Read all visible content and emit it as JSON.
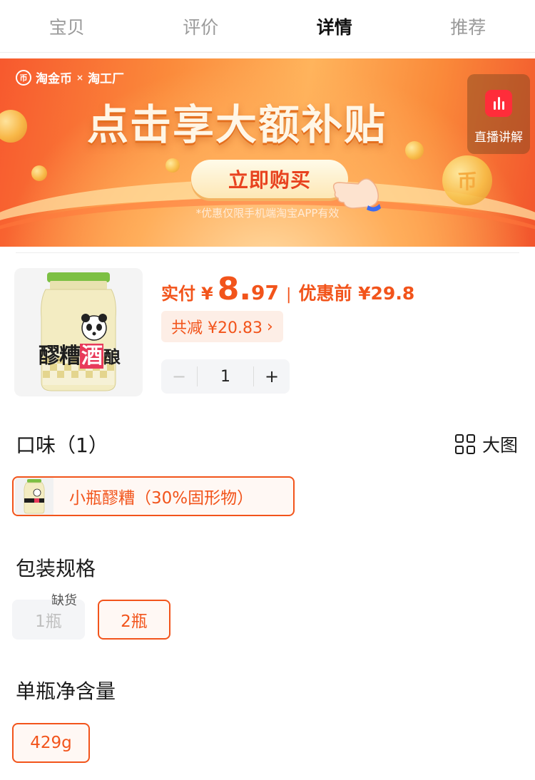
{
  "tabs": [
    {
      "label": "宝贝",
      "active": false
    },
    {
      "label": "评价",
      "active": false
    },
    {
      "label": "详情",
      "active": true
    },
    {
      "label": "推荐",
      "active": false
    }
  ],
  "banner": {
    "brand_left": "淘金币",
    "brand_x": "×",
    "brand_right": "淘工厂",
    "headline": "点击享大额补贴",
    "buy_button": "立即购买",
    "note": "*优惠仅限手机端淘宝APP有效",
    "live_label": "直播讲解",
    "coin_symbol": "币"
  },
  "product": {
    "actual_label": "实付",
    "currency": "¥",
    "price_int": "8.",
    "price_dec": "97",
    "separator": "|",
    "before_label": "优惠前 ¥29.8",
    "discount_text": "共减 ¥20.83",
    "discount_arrow": "›",
    "quantity": "1",
    "minus": "−",
    "plus": "+",
    "jar_label_top": "醪糟",
    "jar_label_accent": "酒",
    "jar_label_end": "酿"
  },
  "flavor": {
    "title": "口味（1）",
    "big_image_label": "大图",
    "options": [
      {
        "label": "小瓶醪糟（30%固形物）",
        "selected": true
      }
    ]
  },
  "package": {
    "title": "包装规格",
    "out_of_stock": "缺货",
    "options": [
      {
        "label": "1瓶",
        "selected": false,
        "disabled": true
      },
      {
        "label": "2瓶",
        "selected": true,
        "disabled": false
      }
    ]
  },
  "net": {
    "title": "单瓶净含量",
    "options": [
      {
        "label": "429g",
        "selected": true
      }
    ]
  },
  "colors": {
    "accent": "#f2541b",
    "selected_bg": "#fff8f4",
    "live_red": "#ff2d3a"
  }
}
